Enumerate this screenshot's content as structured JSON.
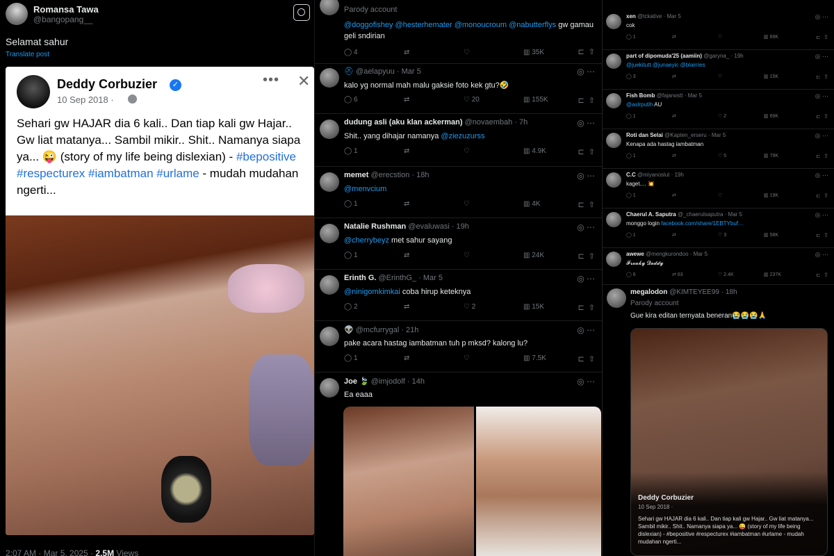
{
  "col1": {
    "user": {
      "name": "Romansa Tawa",
      "handle": "@bangopang__"
    },
    "text": "Selamat sahur",
    "translate": "Translate post",
    "fb": {
      "name": "Deddy Corbuzier",
      "date": "10 Sep 2018 · ",
      "body_prefix": "Sehari gw HAJAR dia 6 kali.. Dan tiap kali gw Hajar.. Gw liat matanya... Sambil mikir.. Shit.. Namanya siapa ya... 😜 (story of my life being dislexian) - ",
      "tags1": "#bepositive #respecturex #iambatman #urlame",
      "body_suffix": " - mudah mudahan ngerti..."
    },
    "footer": {
      "time": "2:07 AM · Mar 5, 2025 · ",
      "views": "2.5M",
      "views_label": " Views"
    }
  },
  "col2": [
    {
      "line1": "Parody account",
      "text_link": "@doggofishey @hesterhemater @monoucroum @nabutterflys",
      "text": " gw gamau",
      "text2": "geli sndirian",
      "actions": [
        "4",
        "",
        "",
        "35K"
      ]
    },
    {
      "handle": "@aelapyuu · Mar 5",
      "text": "kalo yg normal mah malu gaksie foto kek gtu?🤣",
      "actions": [
        "6",
        "",
        "20",
        "155K"
      ]
    },
    {
      "name": "dudung asli (aku klan ackerman)",
      "handle": "@novaembah · 7h",
      "text": "Shit.. yang dihajar namanya ",
      "text_link": "@ziezuzurss",
      "actions": [
        "1",
        "",
        "",
        "4.9K"
      ]
    },
    {
      "name": "memet",
      "handle": "@erecstion · 18h",
      "text_link": "@menvcium",
      "actions": [
        "1",
        "",
        "",
        "4K"
      ]
    },
    {
      "name": "Natalie Rushman",
      "handle": "@evaluwasi · 19h",
      "text_link": "@cherrybeyz",
      "text": " met sahur sayang",
      "actions": [
        "1",
        "",
        "",
        "24K"
      ]
    },
    {
      "name": "Erinth G.",
      "handle": "@ErinthG_ · Mar 5",
      "text_link": "@ninigomkimkai",
      "text": " coba hirup keteknya",
      "actions": [
        "2",
        "",
        "2",
        "15K"
      ]
    },
    {
      "name": "👽",
      "handle": "@mcfurrygal · 21h",
      "text": "pake acara hastag iambatman tuh p mksd? kalong lu?",
      "actions": [
        "1",
        "",
        "",
        "7.5K"
      ]
    },
    {
      "name": "Joe 🍃",
      "handle": "@imjodolf · 14h",
      "text": "Ea eaaa"
    }
  ],
  "col3": [
    {
      "name": "xen",
      "handle": "@tckative · Mar 5",
      "text": "cok",
      "actions": [
        "1",
        "",
        "",
        "69K"
      ]
    },
    {
      "name": "part of dipomuda'25 (aamiin)",
      "handle": "@garyna_ · 19h",
      "text_link": "@juekitutt @junaeyic @blairries",
      "actions": [
        "3",
        "",
        "",
        "15K"
      ]
    },
    {
      "name": "Fish Bomb",
      "handle": "@fajarwstt · Mar 5",
      "text_link": "@aslrputih",
      "text": " AU",
      "actions": [
        "1",
        "",
        "2",
        "69K"
      ]
    },
    {
      "name": "Roti dan Selai",
      "handle": "@Kapten_erseru · Mar 5",
      "text": "Kenapa ada hastag iambatman",
      "actions": [
        "1",
        "",
        "5",
        "79K"
      ]
    },
    {
      "name": "C.C",
      "handle": "@miyanoslut · 19h",
      "text": "kaget.... 💥",
      "actions": [
        "1",
        "",
        "",
        "19K"
      ]
    },
    {
      "name": "Chaerul A. Saputra",
      "handle": "@_chaerulsaputra · Mar 5",
      "text": "monggo login ",
      "text_link": "facebook.com/share/1EBTYbuf…",
      "actions": [
        "1",
        "",
        "3",
        "58K"
      ]
    },
    {
      "name": "awewe",
      "handle": "@mengkurondoo · Mar 5",
      "text": "𝓕𝓻𝓮𝓪𝓴𝔂 𝓓𝓮𝓭𝓭𝔂",
      "actions": [
        "6",
        "63",
        "2.4K",
        "237K"
      ]
    }
  ],
  "mega": {
    "name": "megalodon",
    "handle": "@KIMTEYEE99 · 18h",
    "parody": "Parody account",
    "text": "Gue kira editan ternyata beneran😭😭😭🙏",
    "card_name": "Deddy Corbuzier",
    "card_date": "10 Sep 2018 · ",
    "card_body": "Sehari gw HAJAR dia 6 kali.. Dan tiap kali gw Hajar.. Gw liat matanya... Sambil mikir.. Shit.. Namanya siapa ya... 😜 (story of my life being dislexian) - #bepositive #respecturex #iambatman #urlame - mudah mudahan ngerti..."
  }
}
